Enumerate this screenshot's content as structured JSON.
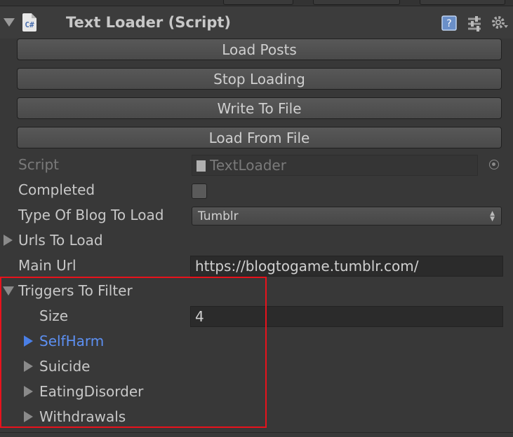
{
  "component": {
    "title": "Text Loader (Script)",
    "icon": "csharp-script-icon",
    "icon_text": "C#"
  },
  "buttons": {
    "load_posts": "Load Posts",
    "stop_loading": "Stop Loading",
    "write_to_file": "Write To File",
    "load_from_file": "Load From File"
  },
  "fields": {
    "script_label": "Script",
    "script_value": "TextLoader",
    "completed_label": "Completed",
    "completed_checked": false,
    "blog_type_label": "Type Of Blog To Load",
    "blog_type_value": "Tumblr",
    "urls_label": "Urls To Load",
    "main_url_label": "Main Url",
    "main_url_value": "https://blogtogame.tumblr.com/",
    "triggers_label": "Triggers To Filter",
    "size_label": "Size",
    "size_value": "4"
  },
  "triggers": [
    "SelfHarm",
    "Suicide",
    "EatingDisorder",
    "Withdrawals"
  ],
  "selected_trigger": "SelfHarm",
  "colors": {
    "background": "#383838",
    "selected_text": "#5d90f2",
    "highlight_border": "#e8121c"
  }
}
